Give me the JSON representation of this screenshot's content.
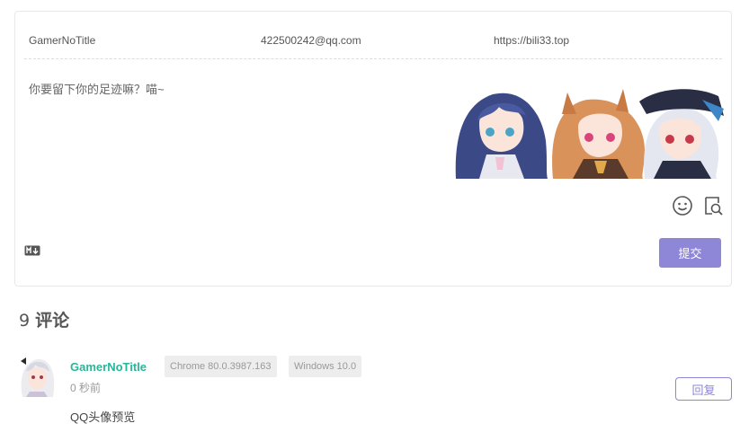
{
  "editor": {
    "nick_value": "GamerNoTitle",
    "mail_value": "422500242@qq.com",
    "link_value": "https://bili33.top",
    "comment_placeholder": "你要留下你的足迹嘛？喵~",
    "emoji_icon": "smiley-face-icon",
    "preview_icon": "preview-search-icon",
    "markdown_icon": "markdown-icon",
    "submit_label": "提交"
  },
  "comments_header": {
    "count": "9",
    "label": "评论"
  },
  "comments": [
    {
      "nick": "GamerNoTitle",
      "browser": "Chrome 80.0.3987.163",
      "os": "Windows 10.0",
      "time": "0 秒前",
      "content": "QQ头像预览",
      "reply_label": "回复"
    }
  ],
  "colors": {
    "accent": "#8e86d6",
    "nick": "#25b79a"
  }
}
